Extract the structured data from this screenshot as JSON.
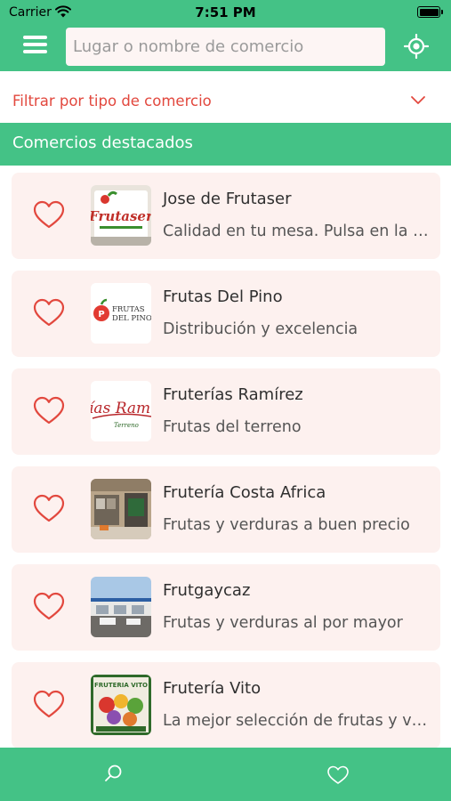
{
  "status_bar": {
    "carrier": "Carrier",
    "time": "7:51 PM"
  },
  "header": {
    "search_placeholder": "Lugar o nombre de comercio",
    "menu_icon": "hamburger-menu-icon",
    "locate_icon": "crosshair-location-icon"
  },
  "filter": {
    "label": "Filtrar por tipo de comercio",
    "icon": "chevron-down-icon"
  },
  "section": {
    "title": "Comercios destacados"
  },
  "shops": [
    {
      "name": "Jose de Frutaser",
      "description": "Calidad en tu mesa. Pulsa en la imagen para ver más",
      "logo_text": "Frutaser",
      "favorite": false
    },
    {
      "name": "Frutas Del Pino",
      "description": "Distribución y excelencia",
      "logo_text": "FRUTAS DEL PINO",
      "favorite": false
    },
    {
      "name": "Fruterías Ramírez",
      "description": "Frutas del terreno",
      "logo_text": "ías Ram",
      "logo_subtext": "Terreno",
      "favorite": false
    },
    {
      "name": "Frutería Costa Africa",
      "description": "Frutas y verduras a buen precio",
      "favorite": false
    },
    {
      "name": "Frutgaycaz",
      "description": "Frutas y verduras al por mayor",
      "favorite": false
    },
    {
      "name": "Frutería Vito",
      "description": "La mejor selección de frutas y verduras",
      "logo_text": "FRUTERIA VITO",
      "favorite": false
    }
  ],
  "tabbar": {
    "tabs": [
      {
        "id": "search",
        "icon": "search-icon"
      },
      {
        "id": "favorites",
        "icon": "heart-icon"
      }
    ]
  },
  "colors": {
    "brand_green": "#44c286",
    "accent_red": "#e2483e",
    "card_background": "#fdf1ef",
    "search_background": "#fdf5f4"
  }
}
